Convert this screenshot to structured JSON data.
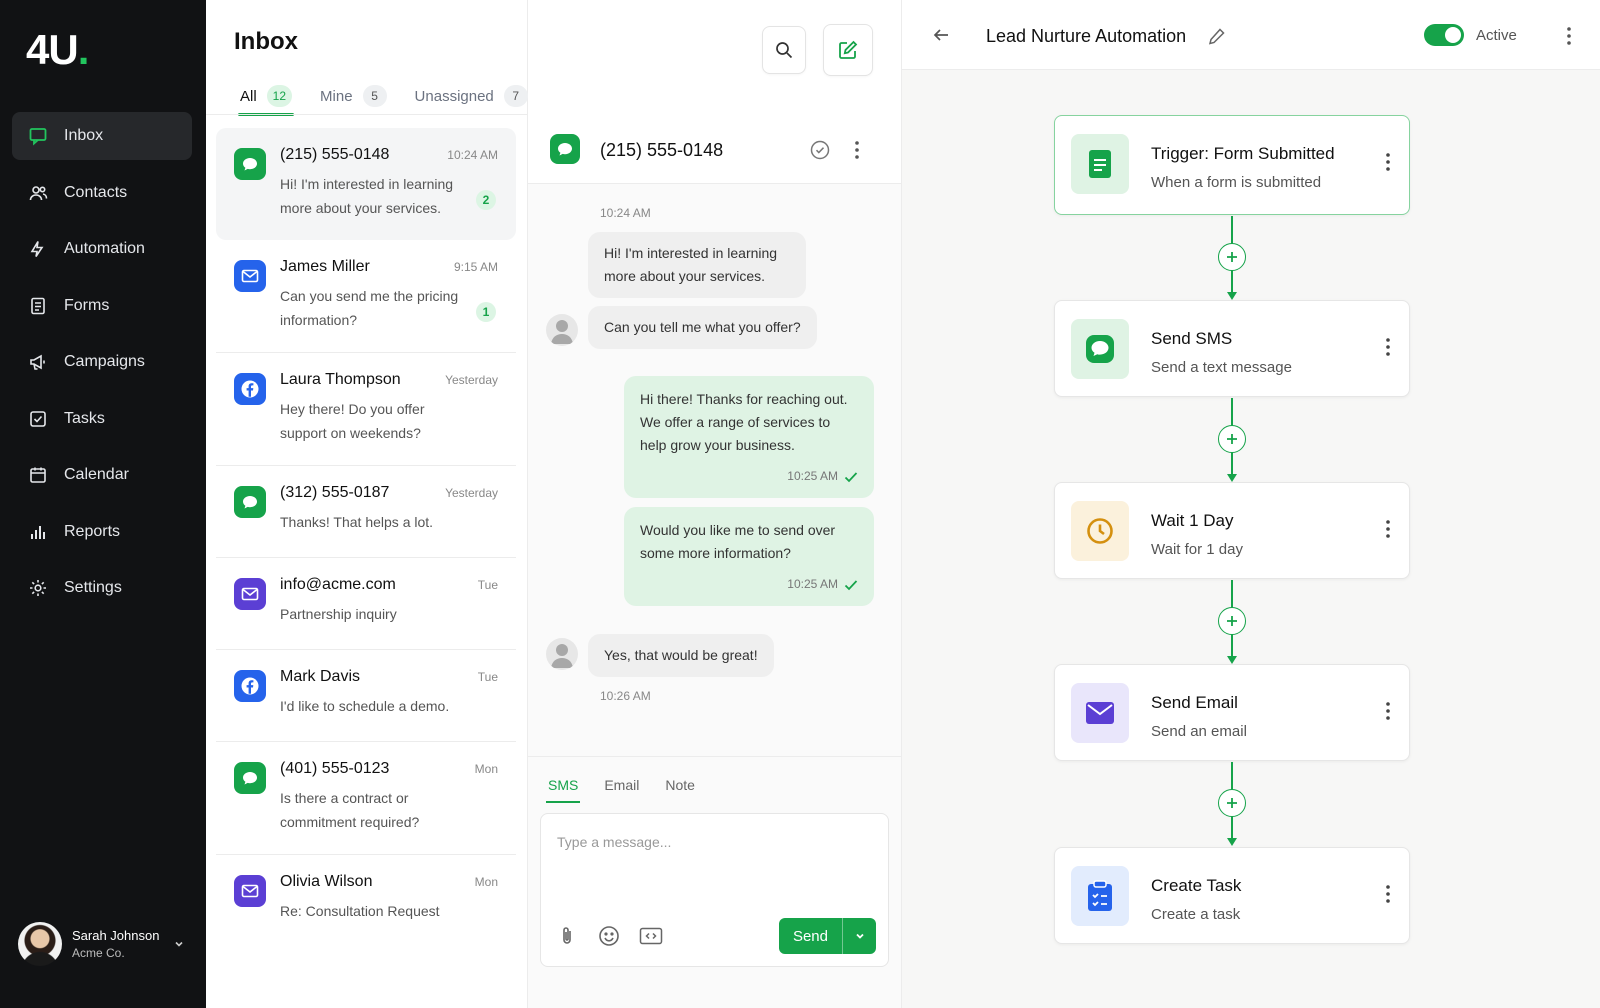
{
  "brand": {
    "logo_text": "4U",
    "logo_dot": "."
  },
  "colors": {
    "accent": "#16a34a",
    "sidebar_bg": "#111214"
  },
  "sidebar": {
    "items": [
      {
        "label": "Inbox",
        "icon": "chat-icon"
      },
      {
        "label": "Contacts",
        "icon": "contacts-icon"
      },
      {
        "label": "Automation",
        "icon": "automation-icon"
      },
      {
        "label": "Forms",
        "icon": "forms-icon"
      },
      {
        "label": "Campaigns",
        "icon": "megaphone-icon"
      },
      {
        "label": "Tasks",
        "icon": "tasks-icon"
      },
      {
        "label": "Calendar",
        "icon": "calendar-icon"
      },
      {
        "label": "Reports",
        "icon": "reports-icon"
      },
      {
        "label": "Settings",
        "icon": "gear-icon"
      }
    ],
    "user": {
      "name": "Sarah Johnson",
      "org": "Acme Co."
    }
  },
  "inbox": {
    "title": "Inbox",
    "tabs": [
      {
        "label": "All",
        "count": "12"
      },
      {
        "label": "Mine",
        "count": "5"
      },
      {
        "label": "Unassigned",
        "count": "7"
      }
    ],
    "conversations": [
      {
        "channel": "sms",
        "name": "(215) 555-0148",
        "time": "10:24 AM",
        "preview": "Hi! I'm interested in learning more about your services.",
        "badge": "2"
      },
      {
        "channel": "email-blue",
        "name": "James Miller",
        "time": "9:15 AM",
        "preview": "Can you send me the pricing information?",
        "badge": "1"
      },
      {
        "channel": "facebook",
        "name": "Laura Thompson",
        "time": "Yesterday",
        "preview": "Hey there! Do you offer support on weekends?"
      },
      {
        "channel": "sms",
        "name": "(312) 555-0187",
        "time": "Yesterday",
        "preview": "Thanks! That helps a lot."
      },
      {
        "channel": "email-purple",
        "name": "info@acme.com",
        "time": "Tue",
        "preview": "Partnership inquiry"
      },
      {
        "channel": "facebook",
        "name": "Mark Davis",
        "time": "Tue",
        "preview": "I'd like to schedule a demo."
      },
      {
        "channel": "sms",
        "name": "(401) 555-0123",
        "time": "Mon",
        "preview": "Is there a contract or commitment required?"
      },
      {
        "channel": "email-purple",
        "name": "Olivia Wilson",
        "time": "Mon",
        "preview": "Re: Consultation Request"
      }
    ]
  },
  "chat": {
    "title": "(215) 555-0148",
    "messages": {
      "m1_time": "10:24 AM",
      "m1": "Hi! I'm interested in learning more about your services.",
      "m2": "Can you tell me what you offer?",
      "m3": "Hi there! Thanks for reaching out. We offer a range of services to help grow your business.",
      "m3_time": "10:25 AM",
      "m4": "Would you like me to send over some more information?",
      "m4_time": "10:25 AM",
      "m5": "Yes, that would be great!",
      "m5_time": "10:26 AM"
    },
    "composer": {
      "tabs": [
        "SMS",
        "Email",
        "Note"
      ],
      "placeholder": "Type a message...",
      "send_label": "Send"
    }
  },
  "automation": {
    "title": "Lead Nurture Automation",
    "status_label": "Active",
    "steps": [
      {
        "title": "Trigger: Form Submitted",
        "subtitle": "When a form is submitted",
        "icon": "form-icon"
      },
      {
        "title": "Send SMS",
        "subtitle": "Send a text message",
        "icon": "sms-icon"
      },
      {
        "title": "Wait 1 Day",
        "subtitle": "Wait for 1 day",
        "icon": "clock-icon"
      },
      {
        "title": "Send Email",
        "subtitle": "Send an email",
        "icon": "email-icon"
      },
      {
        "title": "Create Task",
        "subtitle": "Create a task",
        "icon": "clipboard-icon"
      }
    ]
  }
}
